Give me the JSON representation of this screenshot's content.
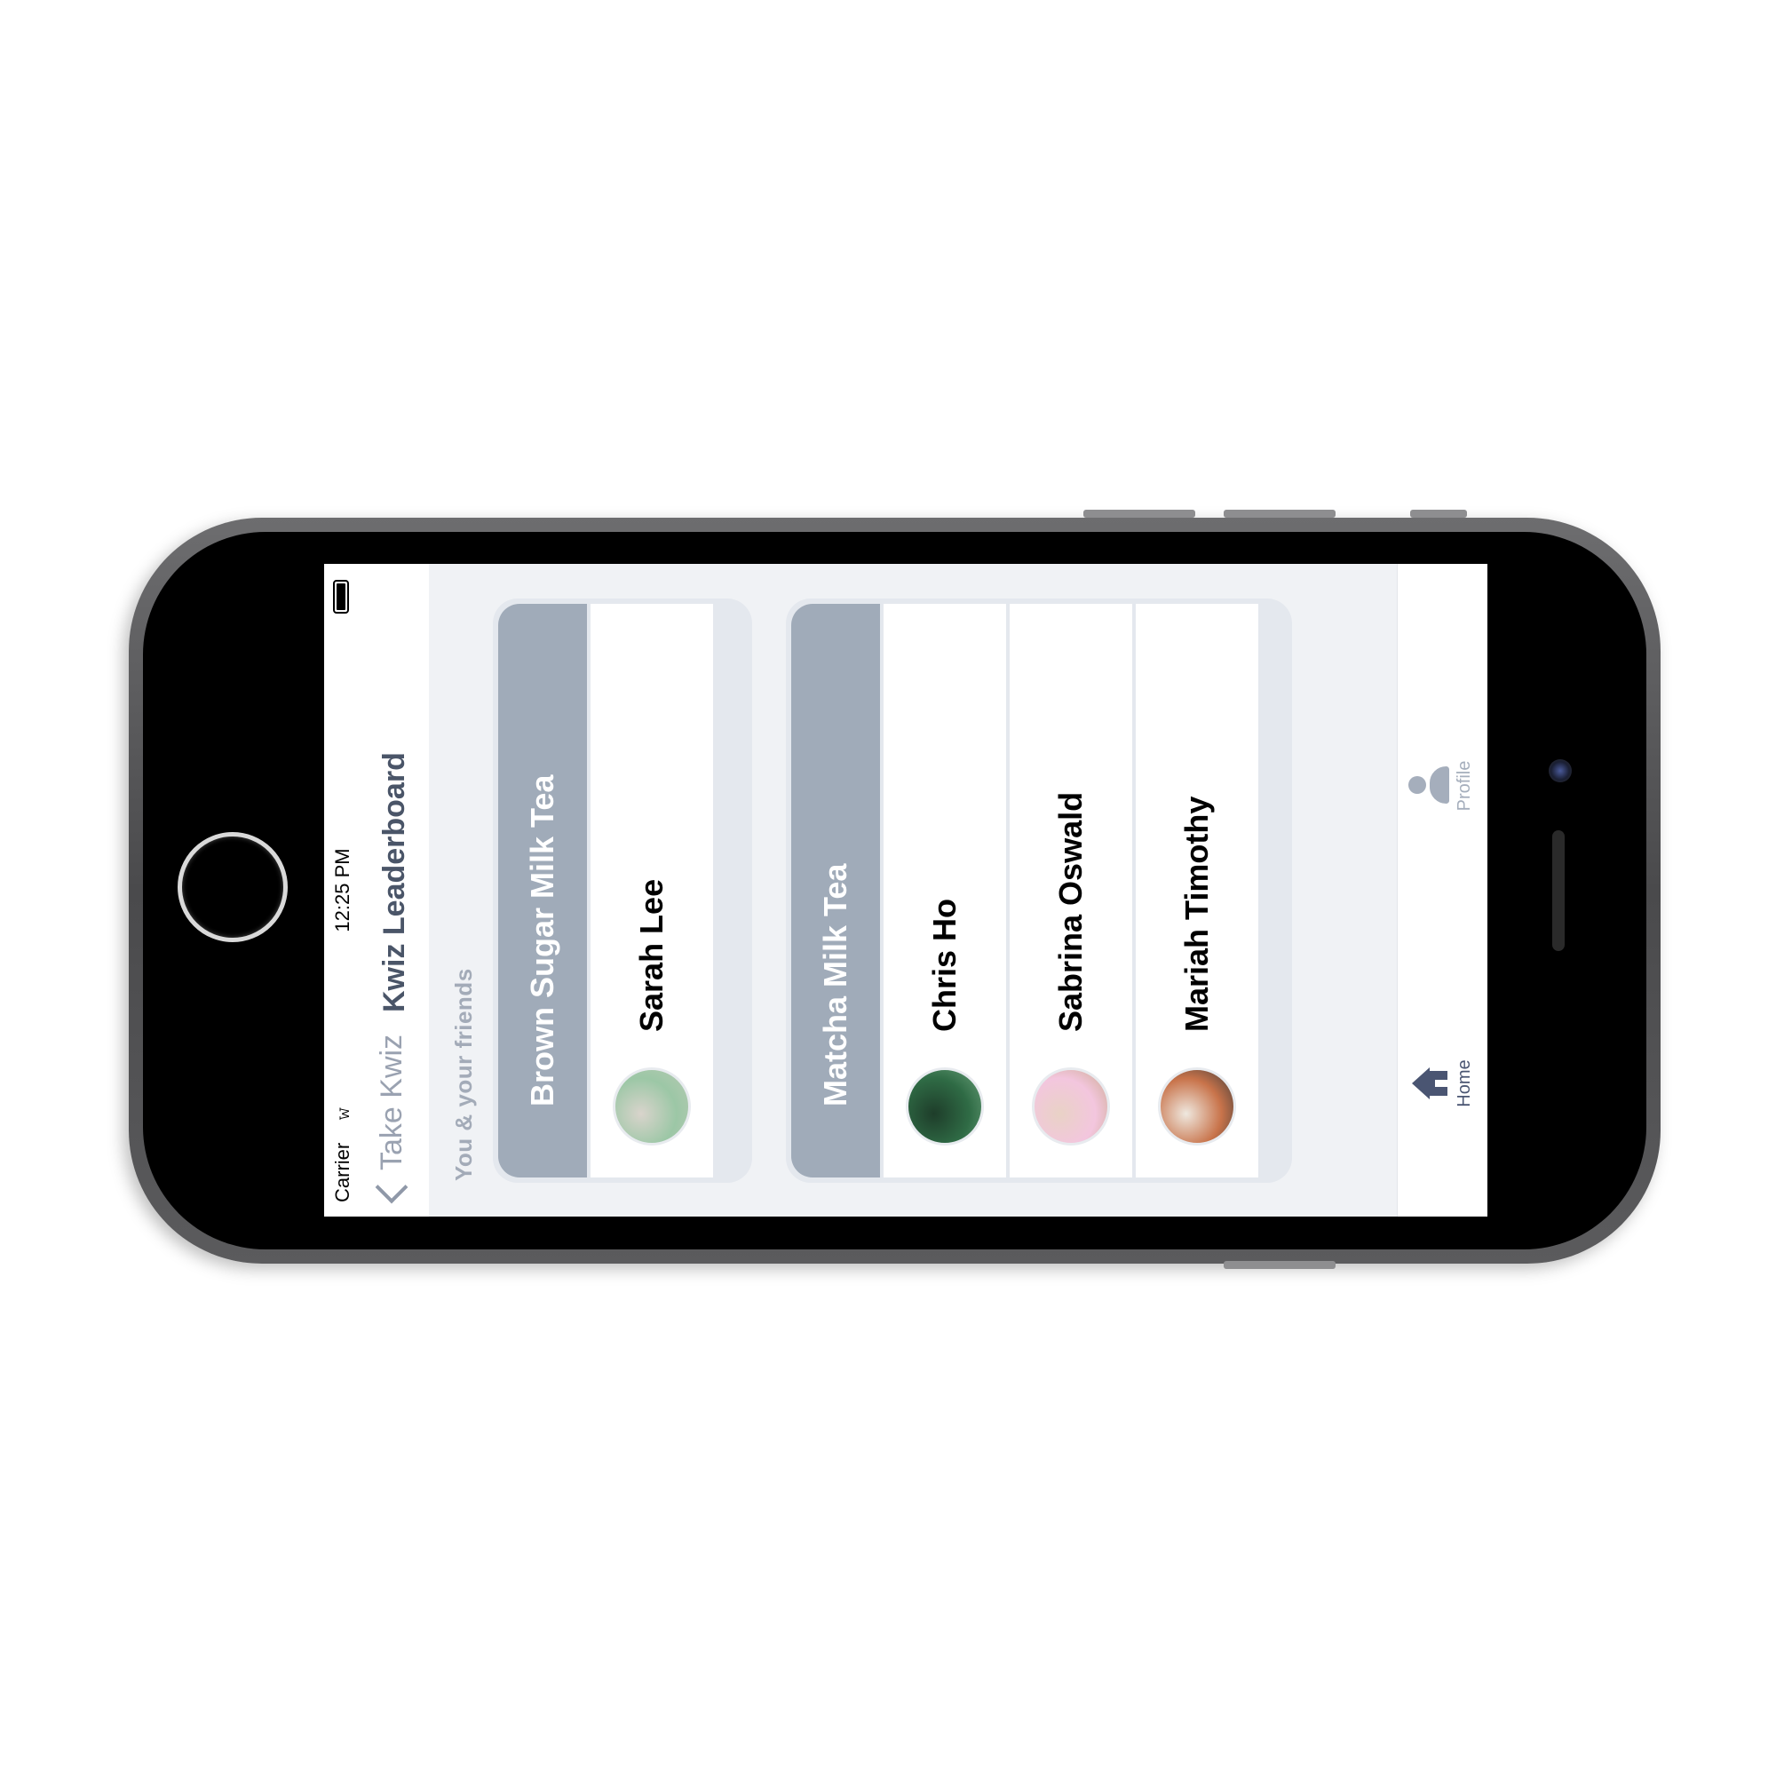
{
  "status_bar": {
    "carrier": "Carrier",
    "time": "12:25 PM",
    "wifi_icon": "wifi-icon",
    "battery_icon": "battery-icon"
  },
  "nav": {
    "back_label": "Take Kwiz",
    "title": "Kwiz Leaderboard"
  },
  "section_label": "You & your friends",
  "groups": [
    {
      "title": "Brown Sugar Milk Tea",
      "members": [
        {
          "name": "Sarah Lee",
          "avatar_colors": [
            "#9cc7a6",
            "#d9d4cc",
            "#b8c9b3"
          ]
        }
      ]
    },
    {
      "title": "Matcha Milk Tea",
      "members": [
        {
          "name": "Chris Ho",
          "avatar_colors": [
            "#2f6b45",
            "#1e3d2a",
            "#6aa07a"
          ]
        },
        {
          "name": "Sabrina Oswald",
          "avatar_colors": [
            "#f3c6de",
            "#e9d2c6",
            "#caa98c"
          ]
        },
        {
          "name": "Mariah Timothy",
          "avatar_colors": [
            "#c8734a",
            "#efe8df",
            "#3b3b3b"
          ]
        }
      ]
    }
  ],
  "tabs": {
    "home_label": "Home",
    "profile_label": "Profile",
    "active_color": "#4a5572",
    "inactive_color": "#a5aebc"
  }
}
